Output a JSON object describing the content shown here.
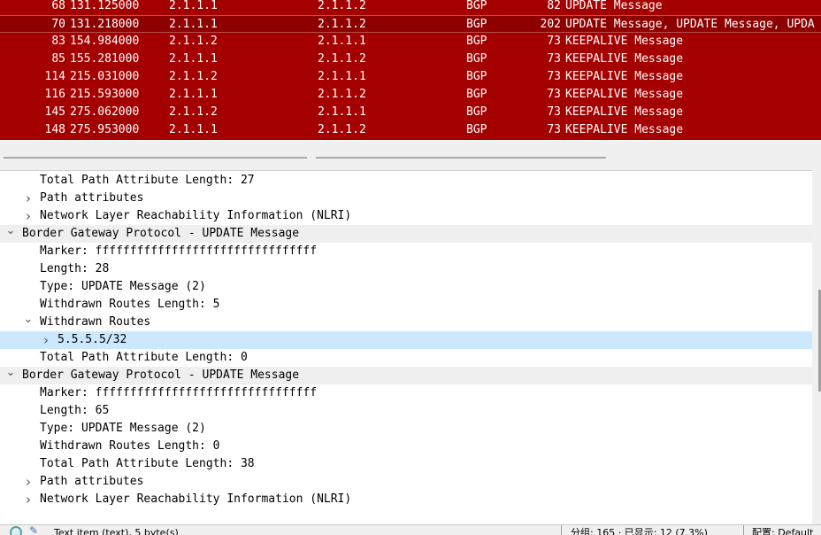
{
  "packet_list": {
    "rows": [
      {
        "no": "68",
        "time": "131.125000",
        "src": "2.1.1.1",
        "dst": "2.1.1.2",
        "proto": "BGP",
        "len": "82",
        "info": "UPDATE Message"
      },
      {
        "no": "70",
        "time": "131.218000",
        "src": "2.1.1.1",
        "dst": "2.1.1.2",
        "proto": "BGP",
        "len": "202",
        "info": "UPDATE Message, UPDATE Message, UPDA"
      },
      {
        "no": "83",
        "time": "154.984000",
        "src": "2.1.1.2",
        "dst": "2.1.1.1",
        "proto": "BGP",
        "len": "73",
        "info": "KEEPALIVE Message"
      },
      {
        "no": "85",
        "time": "155.281000",
        "src": "2.1.1.1",
        "dst": "2.1.1.2",
        "proto": "BGP",
        "len": "73",
        "info": "KEEPALIVE Message"
      },
      {
        "no": "114",
        "time": "215.031000",
        "src": "2.1.1.2",
        "dst": "2.1.1.1",
        "proto": "BGP",
        "len": "73",
        "info": "KEEPALIVE Message"
      },
      {
        "no": "116",
        "time": "215.593000",
        "src": "2.1.1.1",
        "dst": "2.1.1.2",
        "proto": "BGP",
        "len": "73",
        "info": "KEEPALIVE Message"
      },
      {
        "no": "145",
        "time": "275.062000",
        "src": "2.1.1.2",
        "dst": "2.1.1.1",
        "proto": "BGP",
        "len": "73",
        "info": "KEEPALIVE Message"
      },
      {
        "no": "148",
        "time": "275.953000",
        "src": "2.1.1.1",
        "dst": "2.1.1.2",
        "proto": "BGP",
        "len": "73",
        "info": "KEEPALIVE Message"
      }
    ],
    "selected_no": "70",
    "row_color": "#a40000",
    "text_color": "#ffffff"
  },
  "detail_tree": {
    "rows": [
      {
        "text": "Total Path Attribute Length: 27",
        "level": 2,
        "arrow": ""
      },
      {
        "text": "Path attributes",
        "level": 2,
        "arrow": "collapsed"
      },
      {
        "text": "Network Layer Reachability Information (NLRI)",
        "level": 2,
        "arrow": "collapsed"
      },
      {
        "text": "Border Gateway Protocol - UPDATE Message",
        "level": 1,
        "arrow": "expanded",
        "style": "hl"
      },
      {
        "text": "Marker: ffffffffffffffffffffffffffffffff",
        "level": 2,
        "arrow": ""
      },
      {
        "text": "Length: 28",
        "level": 2,
        "arrow": ""
      },
      {
        "text": "Type: UPDATE Message (2)",
        "level": 2,
        "arrow": ""
      },
      {
        "text": "Withdrawn Routes Length: 5",
        "level": 2,
        "arrow": ""
      },
      {
        "text": "Withdrawn Routes",
        "level": 2,
        "arrow": "expanded"
      },
      {
        "text": "5.5.5.5/32",
        "level": 3,
        "arrow": "collapsed",
        "style": "sel"
      },
      {
        "text": "Total Path Attribute Length: 0",
        "level": 2,
        "arrow": ""
      },
      {
        "text": "Border Gateway Protocol - UPDATE Message",
        "level": 1,
        "arrow": "expanded",
        "style": "hl"
      },
      {
        "text": "Marker: ffffffffffffffffffffffffffffffff",
        "level": 2,
        "arrow": ""
      },
      {
        "text": "Length: 65",
        "level": 2,
        "arrow": ""
      },
      {
        "text": "Type: UPDATE Message (2)",
        "level": 2,
        "arrow": ""
      },
      {
        "text": "Withdrawn Routes Length: 0",
        "level": 2,
        "arrow": ""
      },
      {
        "text": "Total Path Attribute Length: 38",
        "level": 2,
        "arrow": ""
      },
      {
        "text": "Path attributes",
        "level": 2,
        "arrow": "collapsed"
      },
      {
        "text": "Network Layer Reachability Information (NLRI)",
        "level": 2,
        "arrow": "collapsed"
      }
    ],
    "icons": {
      "collapsed": "chevron-right-icon",
      "expanded": "chevron-down-icon"
    },
    "selected_color": "#cce8ff"
  },
  "statusbar": {
    "ready_icon": "status-ready-icon",
    "edit_icon": "edit-comment-icon",
    "text": "Text item (text), 5 byte(s)",
    "packets": "分组: 165 · 已显示: 12 (7.3%)",
    "profile": "配置: Default"
  }
}
